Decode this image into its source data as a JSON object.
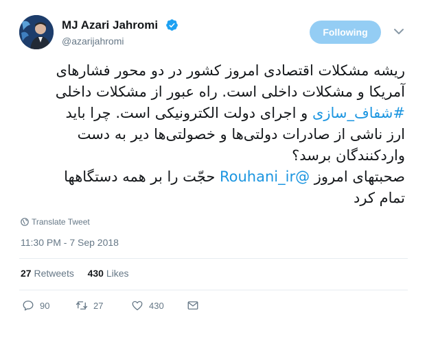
{
  "user": {
    "name": "MJ Azari Jahromi",
    "handle": "@azarijahromi"
  },
  "header": {
    "follow_label": "Following"
  },
  "tweet": {
    "line1": "ریشه مشکلات اقتصادی امروز کشور در دو محور فشارهای",
    "line2": "آمریکا و مشکلات داخلی است. راه عبور از مشکلات داخلی",
    "line3_hashtag": "#شفاف_سازی",
    "line3_rest": "و اجرای دولت الکترونیکی است. چرا باید",
    "line4": "ارز ناشی از صادرات دولتی‌ها و خصولتی‌ها دیر به دست",
    "line5": "واردکنندگان برسد؟",
    "line6_start": "صحبتهای امروز",
    "line6_mention": "@Rouhani_ir",
    "line6_end": "حجّت را بر همه دستگاهها",
    "line7": "تمام کرد"
  },
  "translate_label": "Translate Tweet",
  "timestamp": "11:30 PM - 7 Sep 2018",
  "stats": {
    "retweets_count": "27",
    "retweets_label": "Retweets",
    "likes_count": "430",
    "likes_label": "Likes"
  },
  "actions": {
    "reply_count": "90",
    "retweet_count": "27",
    "like_count": "430"
  },
  "colors": {
    "link": "#1b95e0",
    "follow_button": "#94cdf4",
    "secondary_text": "#657786",
    "divider": "#e6ecf0"
  },
  "icons": [
    "verified-badge-icon",
    "chevron-down-icon",
    "globe-icon",
    "reply-icon",
    "retweet-icon",
    "heart-icon",
    "message-icon"
  ]
}
